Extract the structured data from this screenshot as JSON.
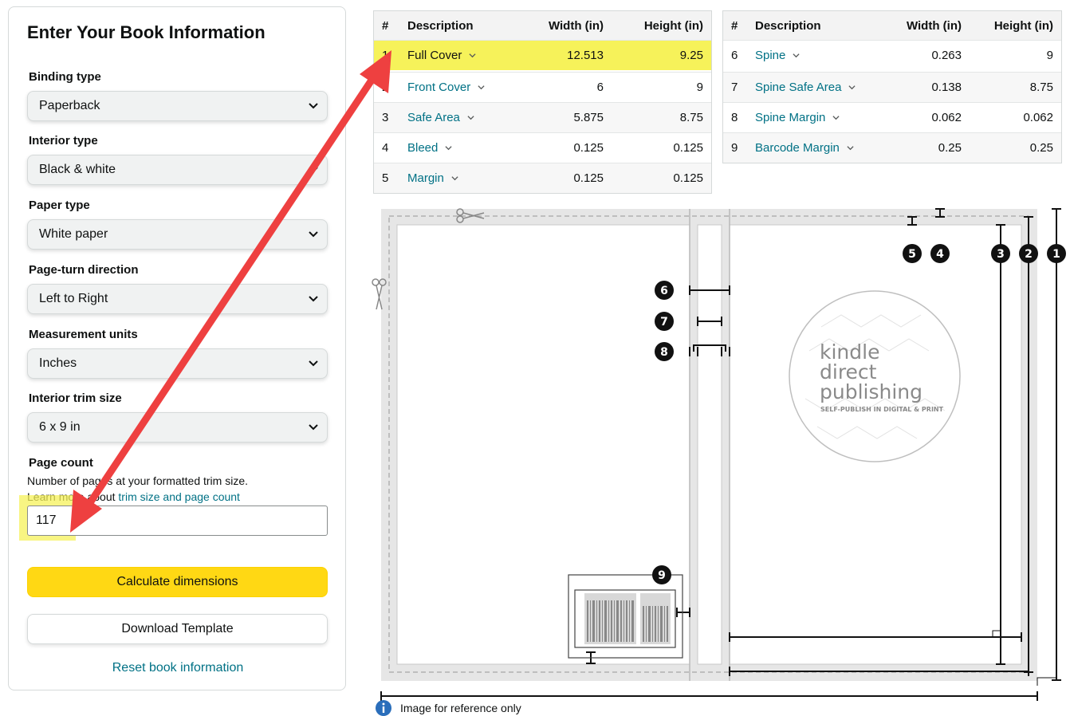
{
  "form": {
    "title": "Enter Your Book Information",
    "binding_label": "Binding type",
    "binding_value": "Paperback",
    "interior_label": "Interior type",
    "interior_value": "Black & white",
    "paper_label": "Paper type",
    "paper_value": "White paper",
    "direction_label": "Page-turn direction",
    "direction_value": "Left to Right",
    "units_label": "Measurement units",
    "units_value": "Inches",
    "trim_label": "Interior trim size",
    "trim_value": "6 x 9 in",
    "pagecount_label": "Page count",
    "pagecount_help1": "Number of pages at your formatted trim size.",
    "pagecount_help2_prefix": "Learn more about ",
    "pagecount_help2_link": "trim size and page count",
    "pagecount_value": "117",
    "calculate_label": "Calculate dimensions",
    "download_label": "Download Template",
    "reset_label": "Reset book information"
  },
  "table_left": {
    "headers": [
      "#",
      "Description",
      "Width (in)",
      "Height (in)"
    ],
    "rows": [
      {
        "n": "1",
        "desc": "Full Cover",
        "w": "12.513",
        "h": "9.25"
      },
      {
        "n": "2",
        "desc": "Front Cover",
        "w": "6",
        "h": "9"
      },
      {
        "n": "3",
        "desc": "Safe Area",
        "w": "5.875",
        "h": "8.75"
      },
      {
        "n": "4",
        "desc": "Bleed",
        "w": "0.125",
        "h": "0.125"
      },
      {
        "n": "5",
        "desc": "Margin",
        "w": "0.125",
        "h": "0.125"
      }
    ]
  },
  "table_right": {
    "headers": [
      "#",
      "Description",
      "Width (in)",
      "Height (in)"
    ],
    "rows": [
      {
        "n": "6",
        "desc": "Spine",
        "w": "0.263",
        "h": "9"
      },
      {
        "n": "7",
        "desc": "Spine Safe Area",
        "w": "0.138",
        "h": "8.75"
      },
      {
        "n": "8",
        "desc": "Spine Margin",
        "w": "0.062",
        "h": "0.062"
      },
      {
        "n": "9",
        "desc": "Barcode Margin",
        "w": "0.25",
        "h": "0.25"
      }
    ]
  },
  "diagram": {
    "markers": [
      "1",
      "2",
      "3",
      "4",
      "5",
      "6",
      "7",
      "8",
      "9"
    ],
    "logo_line1": "kindle",
    "logo_line2": "direct",
    "logo_line3": "publishing",
    "logo_tagline": "SELF-PUBLISH IN DIGITAL & PRINT"
  },
  "reference_note": "Image for reference only",
  "icons": {
    "select_chevron": "chevron-down-icon",
    "row_dropdown": "chevron-down-icon",
    "info": "info-icon",
    "scissors": "scissors-icon"
  },
  "colors": {
    "accent_yellow": "#ffd814",
    "highlight": "#f6f25a",
    "link": "#007185",
    "arrow": "#ee4040"
  }
}
